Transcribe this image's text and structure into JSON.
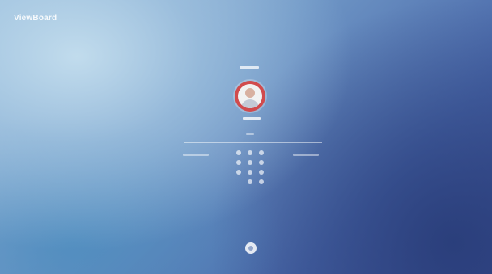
{
  "brand": {
    "label": "ViewBoard"
  },
  "icons": {
    "avatar": "user-avatar-icon",
    "power": "power-icon"
  },
  "colors": {
    "avatar_ring": "#d14b4d"
  }
}
